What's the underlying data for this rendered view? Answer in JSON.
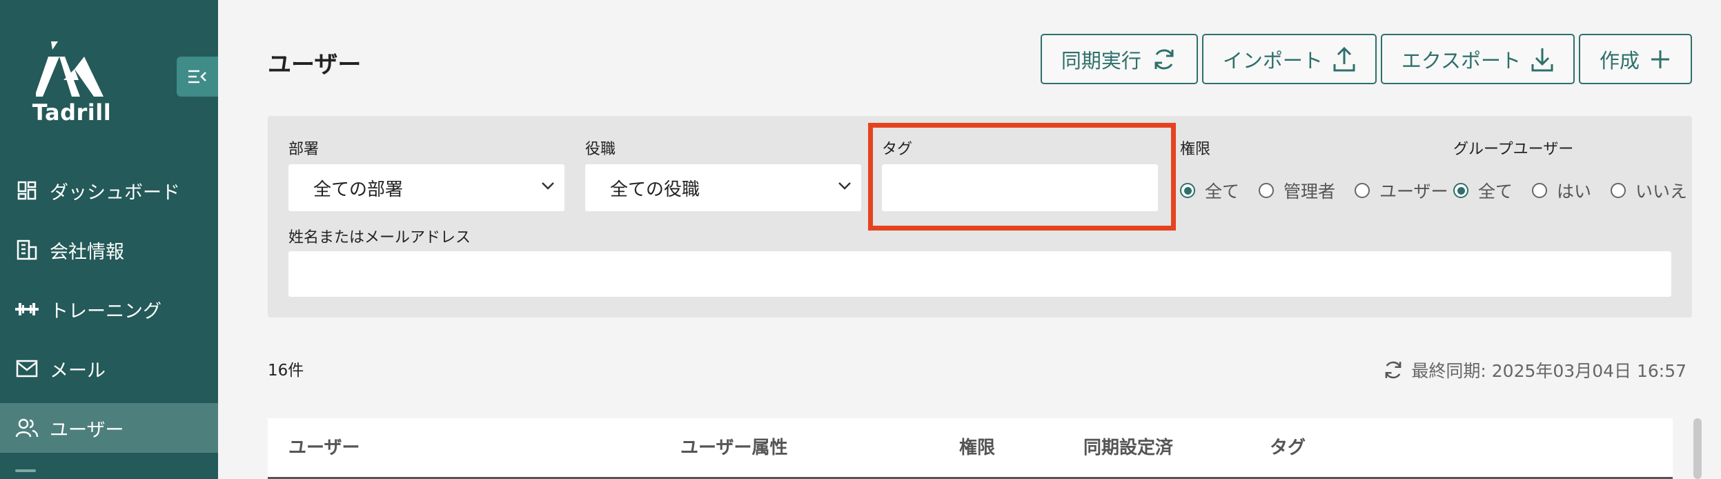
{
  "brand": {
    "name": "Tadrill"
  },
  "sidebar": {
    "items": [
      {
        "label": "ダッシュボード",
        "icon": "dashboard-icon"
      },
      {
        "label": "会社情報",
        "icon": "building-icon"
      },
      {
        "label": "トレーニング",
        "icon": "dumbbell-icon"
      },
      {
        "label": "メール",
        "icon": "mail-icon"
      },
      {
        "label": "ユーザー",
        "icon": "users-icon",
        "active": true
      }
    ]
  },
  "page": {
    "title": "ユーザー"
  },
  "toolbar": {
    "sync_label": "同期実行",
    "import_label": "インポート",
    "export_label": "エクスポート",
    "create_label": "作成"
  },
  "filters": {
    "department": {
      "label": "部署",
      "value": "全ての部署"
    },
    "position": {
      "label": "役職",
      "value": "全ての役職"
    },
    "tag": {
      "label": "タグ",
      "value": ""
    },
    "permission": {
      "label": "権限",
      "options": [
        "全て",
        "管理者",
        "ユーザー"
      ],
      "selected": "全て"
    },
    "group_user": {
      "label": "グループユーザー",
      "options": [
        "全て",
        "はい",
        "いいえ"
      ],
      "selected": "全て"
    },
    "name_email": {
      "label": "姓名またはメールアドレス",
      "value": ""
    }
  },
  "results": {
    "count": "16件",
    "last_sync": "最終同期: 2025年03月04日 16:57"
  },
  "table": {
    "headers": [
      "ユーザー",
      "ユーザー属性",
      "権限",
      "同期設定済",
      "タグ"
    ]
  },
  "colors": {
    "sidebar": "#245a59",
    "accent": "#2e6f6c",
    "highlight": "#e5431f"
  }
}
